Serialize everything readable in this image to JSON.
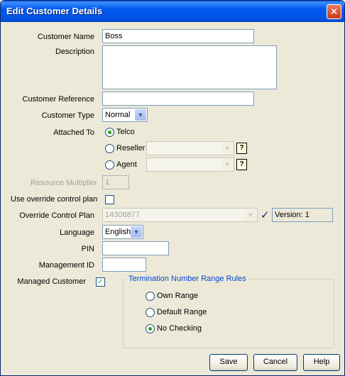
{
  "window": {
    "title": "Edit Customer Details",
    "close_icon": "close-icon"
  },
  "form": {
    "customer_name": {
      "label": "Customer Name",
      "value": "Boss"
    },
    "description": {
      "label": "Description",
      "value": ""
    },
    "customer_reference": {
      "label": "Customer Reference",
      "value": ""
    },
    "customer_type": {
      "label": "Customer Type",
      "value": "Normal"
    },
    "attached_to": {
      "label": "Attached To",
      "options": [
        "Telco",
        "Reseller",
        "Agent"
      ],
      "selected": "Telco"
    },
    "resource_multiplier": {
      "label": "Resource Multiplier",
      "value": "1"
    },
    "use_override": {
      "label": "Use override control plan",
      "checked": false
    },
    "override_control_plan": {
      "label": "Override Control Plan",
      "value": "14306877",
      "version": "Version: 1"
    },
    "language": {
      "label": "Language",
      "value": "English"
    },
    "pin": {
      "label": "PIN",
      "value": ""
    },
    "management_id": {
      "label": "Management ID",
      "value": ""
    },
    "managed_customer": {
      "label": "Managed Customer",
      "checked": true
    },
    "termination_rules": {
      "legend": "Termination Number Range Rules",
      "options": [
        "Own Range",
        "Default Range",
        "No Checking"
      ],
      "selected": "No Checking"
    }
  },
  "buttons": {
    "save": "Save",
    "cancel": "Cancel",
    "help": "Help"
  },
  "help_glyph": "?",
  "colors": {
    "titlebar": "#0054e3",
    "window_bg": "#ece9d8",
    "radio_dot": "#21a121",
    "legend": "#0046d5"
  }
}
